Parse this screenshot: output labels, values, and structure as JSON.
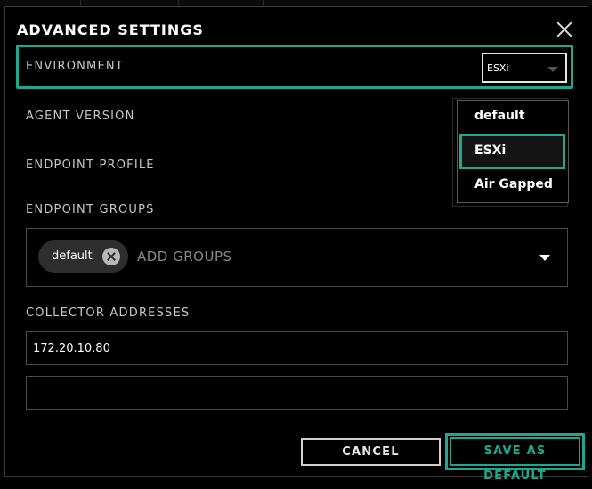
{
  "dialog": {
    "title": "ADVANCED SETTINGS"
  },
  "environment": {
    "label": "ENVIRONMENT",
    "selected": "ESXi",
    "options": [
      "default",
      "ESXi",
      "Air Gapped"
    ]
  },
  "agent_version": {
    "label": "AGENT VERSION"
  },
  "endpoint_profile": {
    "label": "ENDPOINT PROFILE"
  },
  "endpoint_groups": {
    "label": "ENDPOINT GROUPS",
    "chips": [
      "default"
    ],
    "placeholder": "ADD GROUPS"
  },
  "collector_addresses": {
    "label": "COLLECTOR ADDRESSES",
    "values": [
      "172.20.10.80",
      ""
    ]
  },
  "buttons": {
    "cancel": "CANCEL",
    "save_default": "SAVE AS DEFAULT"
  },
  "colors": {
    "accent": "#1fa88f",
    "background": "#000000"
  }
}
